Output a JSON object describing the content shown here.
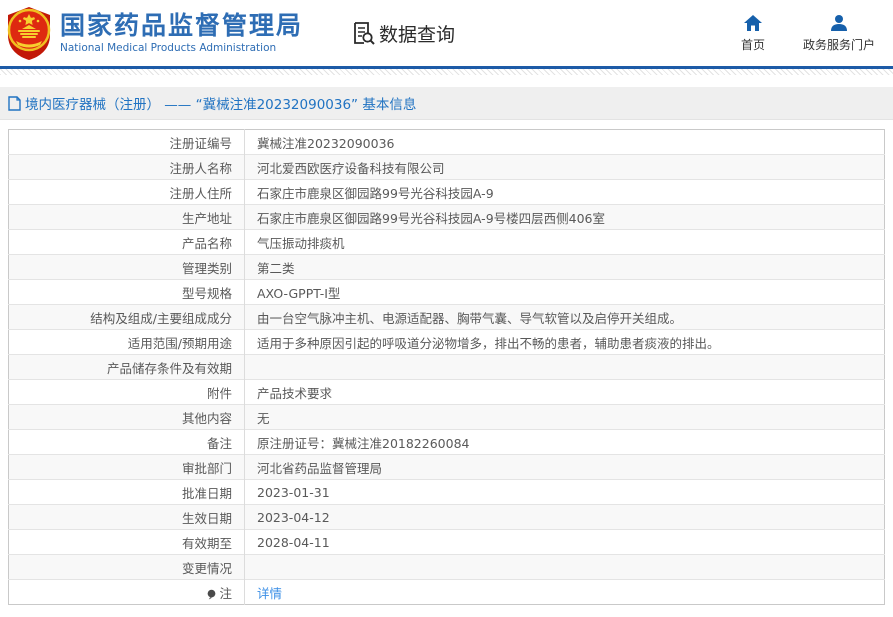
{
  "header": {
    "title_cn": "国家药品监督管理局",
    "title_en": "National Medical Products Administration",
    "query_label": "数据查询",
    "nav": {
      "home": "首页",
      "portal": "政务服务门户"
    }
  },
  "breadcrumb": {
    "text": "境内医疗器械（注册） —— “冀械注准20232090036” 基本信息"
  },
  "table": {
    "rows": [
      {
        "label": "注册证编号",
        "value": "冀械注准20232090036"
      },
      {
        "label": "注册人名称",
        "value": "河北爱西欧医疗设备科技有限公司"
      },
      {
        "label": "注册人住所",
        "value": "石家庄市鹿泉区御园路99号光谷科技园A-9"
      },
      {
        "label": "生产地址",
        "value": "石家庄市鹿泉区御园路99号光谷科技园A-9号楼四层西侧406室"
      },
      {
        "label": "产品名称",
        "value": "气压振动排痰机"
      },
      {
        "label": "管理类别",
        "value": "第二类"
      },
      {
        "label": "型号规格",
        "value": "AXO-GPPT-Ⅰ型"
      },
      {
        "label": "结构及组成/主要组成成分",
        "value": "由一台空气脉冲主机、电源适配器、胸带气囊、导气软管以及启停开关组成。"
      },
      {
        "label": "适用范围/预期用途",
        "value": "适用于多种原因引起的呼吸道分泌物增多，排出不畅的患者，辅助患者痰液的排出。"
      },
      {
        "label": "产品储存条件及有效期",
        "value": ""
      },
      {
        "label": "附件",
        "value": "产品技术要求"
      },
      {
        "label": "其他内容",
        "value": "无"
      },
      {
        "label": "备注",
        "value": "原注册证号：冀械注准20182260084"
      },
      {
        "label": "审批部门",
        "value": "河北省药品监督管理局"
      },
      {
        "label": "批准日期",
        "value": "2023-01-31"
      },
      {
        "label": "生效日期",
        "value": "2023-04-12"
      },
      {
        "label": "有效期至",
        "value": "2028-04-11"
      },
      {
        "label": "变更情况",
        "value": ""
      },
      {
        "label": "注",
        "value": "详情",
        "label_icon": "note-icon",
        "value_is_link": true
      }
    ]
  },
  "colors": {
    "brand_blue": "#2e6db4",
    "rule_blue": "#1d5ba7",
    "nav_icon_blue": "#1660ab",
    "breadcrumb_blue": "#2173c2",
    "link_blue": "#3a8ee6",
    "emblem_red": "#de2910",
    "emblem_gold": "#f7d02e",
    "row_alt_bg": "#f8f8f8"
  }
}
